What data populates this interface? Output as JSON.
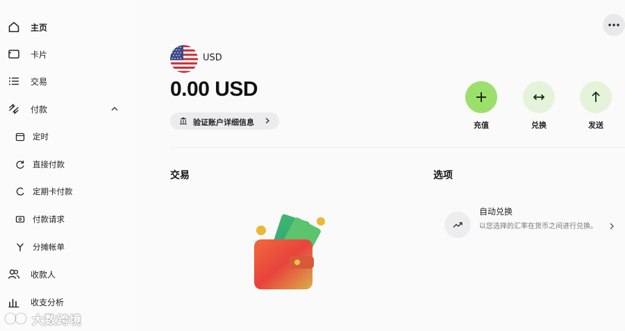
{
  "sidebar": {
    "items": [
      {
        "label": "主页",
        "icon": "home-icon",
        "active": true
      },
      {
        "label": "卡片",
        "icon": "card-icon"
      },
      {
        "label": "交易",
        "icon": "list-icon"
      },
      {
        "label": "付款",
        "icon": "transfer-icon",
        "expanded": true
      },
      {
        "label": "定时",
        "icon": "calendar-icon",
        "sub": true
      },
      {
        "label": "直接付款",
        "icon": "refresh-icon",
        "sub": true
      },
      {
        "label": "定期卡付款",
        "icon": "recurring-icon",
        "sub": true
      },
      {
        "label": "付款请求",
        "icon": "request-icon",
        "sub": true
      },
      {
        "label": "分摊帐单",
        "icon": "split-icon",
        "sub": true
      },
      {
        "label": "收款人",
        "icon": "people-icon"
      },
      {
        "label": "收支分析",
        "icon": "chart-icon"
      }
    ]
  },
  "account": {
    "currency_code": "USD",
    "balance": "0.00 USD",
    "verify_label": "验证账户详细信息",
    "flag_icon": "us-flag-icon"
  },
  "actions": [
    {
      "label": "充值",
      "icon": "plus-icon",
      "bg": "#9be06c"
    },
    {
      "label": "兑换",
      "icon": "exchange-icon",
      "bg": "#e6f3db"
    },
    {
      "label": "发送",
      "icon": "arrow-up-icon",
      "bg": "#e6f3db"
    }
  ],
  "transactions": {
    "title": "交易",
    "empty_illustration": "wallet-illustration"
  },
  "options": {
    "title": "选项",
    "items": [
      {
        "title": "自动兑换",
        "description": "以您选择的汇率在货币之间进行兑换。",
        "icon": "trend-icon"
      }
    ]
  },
  "watermark": {
    "text": "大数跨境"
  },
  "colors": {
    "accent": "#9be06c",
    "accent_light": "#e6f3db"
  }
}
